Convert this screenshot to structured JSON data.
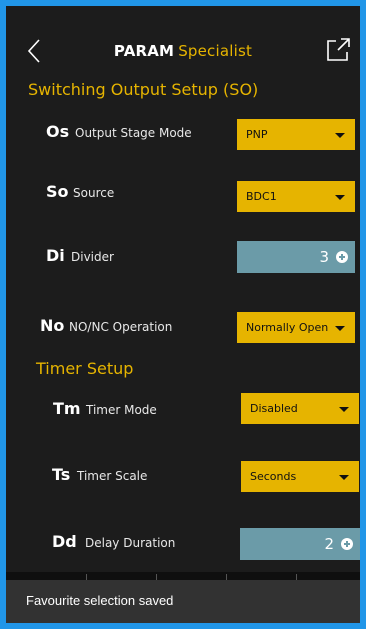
{
  "header": {
    "title_bold": "PARAM",
    "title_accent": "Specialist"
  },
  "colors": {
    "accent": "#e6b400",
    "field_bg": "#6b9ba8",
    "frame": "#2196e8",
    "background": "#1c1c1c"
  },
  "sections": {
    "switching": "Switching Output Setup (SO)",
    "timer": "Timer Setup"
  },
  "params": {
    "os": {
      "code": "Os",
      "label": "Output Stage Mode",
      "value": "PNP"
    },
    "so": {
      "code": "So",
      "label": "Source",
      "value": "BDC1"
    },
    "di": {
      "code": "Di",
      "label": "Divider",
      "value": "3"
    },
    "no": {
      "code": "No",
      "label": "NO/NC Operation",
      "value": "Normally Open"
    },
    "tm": {
      "code": "Tm",
      "label": "Timer Mode",
      "value": "Disabled"
    },
    "ts": {
      "code": "Ts",
      "label": "Timer Scale",
      "value": "Seconds"
    },
    "dd": {
      "code": "Dd",
      "label": "Delay Duration",
      "value": "2"
    }
  },
  "snackbar": {
    "message": "Favourite selection saved"
  }
}
